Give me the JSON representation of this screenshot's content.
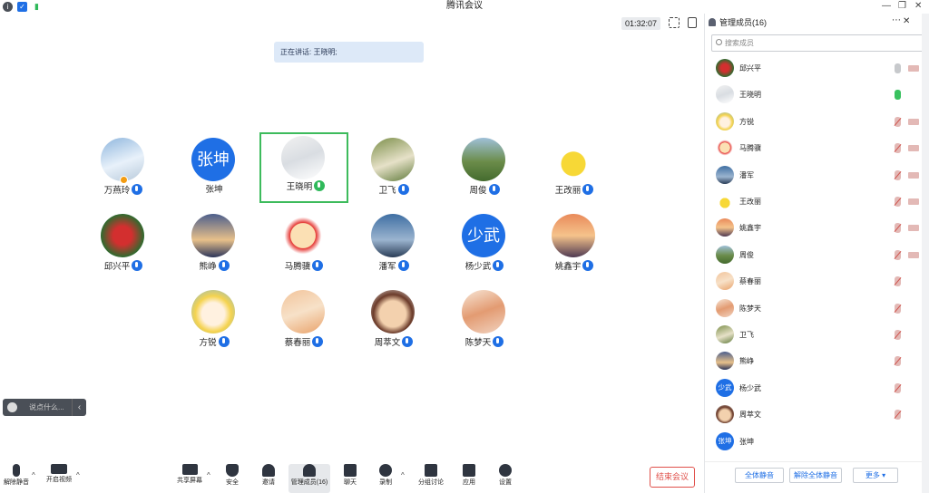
{
  "window": {
    "title": "腾讯会议"
  },
  "status": {
    "timer": "01:32:07",
    "speaking_label": "正在讲话: 王晓明;"
  },
  "participants": [
    {
      "name": "万燕玲",
      "avatar": "snow-mountain",
      "mic": "blue",
      "host": true
    },
    {
      "name": "张坤",
      "avatar_text": "张坤",
      "mic": "none"
    },
    {
      "name": "王晓明",
      "avatar": "person-photo",
      "mic": "green",
      "active": true
    },
    {
      "name": "卫飞",
      "avatar": "flower-photo",
      "mic": "blue"
    },
    {
      "name": "周俊",
      "avatar": "landscape-photo",
      "mic": "blue"
    },
    {
      "name": "王改丽",
      "avatar": "pikachu",
      "mic": "blue"
    },
    {
      "name": "邱兴平",
      "avatar": "red-flowers",
      "mic": "blue"
    },
    {
      "name": "熊峥",
      "avatar": "city-lights",
      "mic": "blue"
    },
    {
      "name": "马腾骥",
      "avatar": "cartoon-boy",
      "mic": "blue"
    },
    {
      "name": "潘军",
      "avatar": "sky-photo",
      "mic": "blue"
    },
    {
      "name": "杨少武",
      "avatar_text": "少武",
      "mic": "blue"
    },
    {
      "name": "姚鑫宇",
      "avatar": "sunset-photo",
      "mic": "blue"
    },
    {
      "name": "方锐",
      "avatar": "anime-girl",
      "mic": "blue"
    },
    {
      "name": "蔡春丽",
      "avatar": "girl-photo",
      "mic": "blue"
    },
    {
      "name": "周萃文",
      "avatar": "cartoon-laugh",
      "mic": "blue"
    },
    {
      "name": "陈梦天",
      "avatar": "food-photo",
      "mic": "blue"
    }
  ],
  "chat": {
    "placeholder": "说点什么..."
  },
  "toolbar": {
    "unmute": "解除静音",
    "video": "开启视频",
    "share": "共享屏幕",
    "security": "安全",
    "invite": "邀请",
    "members": "管理成员(16)",
    "chat": "聊天",
    "record": "录制",
    "breakout": "分组讨论",
    "apps": "应用",
    "settings": "设置",
    "end": "结束会议"
  },
  "panel": {
    "title": "管理成员(16)",
    "search_placeholder": "搜索成员",
    "members": [
      {
        "name": "邱兴平",
        "mic": "gray",
        "cam": "muted"
      },
      {
        "name": "王晓明",
        "mic": "green",
        "cam": "none"
      },
      {
        "name": "方锐",
        "mic": "muted",
        "cam": "muted"
      },
      {
        "name": "马腾骥",
        "mic": "muted",
        "cam": "muted"
      },
      {
        "name": "潘军",
        "mic": "muted",
        "cam": "muted"
      },
      {
        "name": "王改丽",
        "mic": "muted",
        "cam": "muted"
      },
      {
        "name": "姚鑫宇",
        "mic": "muted",
        "cam": "muted"
      },
      {
        "name": "周俊",
        "mic": "muted",
        "cam": "muted"
      },
      {
        "name": "蔡春丽",
        "mic": "muted",
        "cam": "none"
      },
      {
        "name": "陈梦天",
        "mic": "muted",
        "cam": "none"
      },
      {
        "name": "卫飞",
        "mic": "muted",
        "cam": "none"
      },
      {
        "name": "熊峥",
        "mic": "muted",
        "cam": "none"
      },
      {
        "name": "杨少武",
        "avatar_text": "少武",
        "mic": "muted",
        "cam": "none"
      },
      {
        "name": "周萃文",
        "mic": "muted",
        "cam": "none"
      },
      {
        "name": "张坤",
        "avatar_text": "张坤",
        "mic": "none",
        "cam": "none"
      }
    ],
    "mute_all": "全体静音",
    "unmute_all": "解除全体静音",
    "more": "更多"
  },
  "colors": {
    "accent": "#1f6fe5",
    "active_border": "#3dbb5c",
    "end": "#e0504a"
  }
}
